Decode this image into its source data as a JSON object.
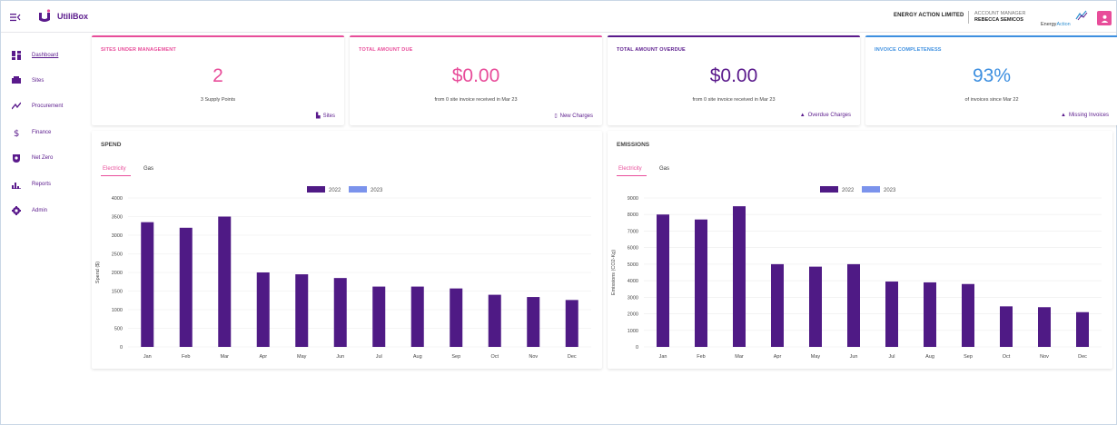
{
  "app": {
    "name": "UtiliBox"
  },
  "header": {
    "company": "ENERGY ACTION LIMITED",
    "account_label": "ACCOUNT MANAGER",
    "account_name": "REBECCA SEMICOS",
    "partner_logo_a": "Energy",
    "partner_logo_b": "Action"
  },
  "sidebar": {
    "items": [
      {
        "label": "Dashboard",
        "icon": "dashboard-icon",
        "active": true
      },
      {
        "label": "Sites",
        "icon": "sites-icon",
        "active": false
      },
      {
        "label": "Procurement",
        "icon": "procurement-icon",
        "active": false
      },
      {
        "label": "Finance",
        "icon": "dollar-icon",
        "active": false
      },
      {
        "label": "Net Zero",
        "icon": "leaf-icon",
        "active": false
      },
      {
        "label": "Reports",
        "icon": "bar-chart-icon",
        "active": false
      },
      {
        "label": "Admin",
        "icon": "gear-icon",
        "active": false
      }
    ]
  },
  "stats": [
    {
      "title": "SITES UNDER MANAGEMENT",
      "value": "2",
      "sub": "3 Supply Points",
      "link": "Sites",
      "color": "#e84d9a",
      "value_color": "#e84d9a"
    },
    {
      "title": "TOTAL AMOUNT DUE",
      "value": "$0.00",
      "sub": "from 0 site invoice received in Mar 23",
      "link": "New Charges",
      "color": "#e84d9a",
      "value_color": "#e84d9a"
    },
    {
      "title": "TOTAL AMOUNT OVERDUE",
      "value": "$0.00",
      "sub": "from 0 site invoice received in Mar 23",
      "link": "Overdue Charges",
      "color": "#5a1a8c",
      "value_color": "#5a1a8c"
    },
    {
      "title": "INVOICE COMPLETENESS",
      "value": "93%",
      "sub": "of invoices since Mar 22",
      "link": "Missing Invoices",
      "color": "#3d8fe0",
      "value_color": "#3d8fe0"
    }
  ],
  "charts": {
    "spend": {
      "title": "SPEND",
      "tab_active": "Electricity",
      "tab_inactive": "Gas"
    },
    "emissions": {
      "title": "EMISSIONS",
      "tab_active": "Electricity",
      "tab_inactive": "Gas"
    }
  },
  "colors": {
    "series_2022": "#4f1a85",
    "series_2023": "#7b93ec",
    "accent_pink": "#e84d9a",
    "brand_purple": "#5a1a8c",
    "invoice_blue": "#3d8fe0"
  },
  "chart_data": [
    {
      "type": "bar",
      "title": "SPEND",
      "ylabel": "Spend ($)",
      "xlabel": "",
      "categories": [
        "Jan",
        "Feb",
        "Mar",
        "Apr",
        "May",
        "Jun",
        "Jul",
        "Aug",
        "Sep",
        "Oct",
        "Nov",
        "Dec"
      ],
      "series": [
        {
          "name": "2022",
          "values": [
            3350,
            3200,
            3500,
            2000,
            1950,
            1850,
            1620,
            1620,
            1570,
            1400,
            1340,
            1260
          ]
        },
        {
          "name": "2023",
          "values": [
            0,
            0,
            0,
            0,
            0,
            0,
            0,
            0,
            0,
            0,
            0,
            0
          ]
        }
      ],
      "ylim": [
        0,
        4000
      ],
      "yticks": [
        0,
        500,
        1000,
        1500,
        2000,
        2500,
        3000,
        3500,
        4000
      ],
      "grid": true,
      "legend": "top-center"
    },
    {
      "type": "bar",
      "title": "EMISSIONS",
      "ylabel": "Emissions (CO2-Kg)",
      "xlabel": "",
      "categories": [
        "Jan",
        "Feb",
        "Mar",
        "Apr",
        "May",
        "Jun",
        "Jul",
        "Aug",
        "Sep",
        "Oct",
        "Nov",
        "Dec"
      ],
      "series": [
        {
          "name": "2022",
          "values": [
            8000,
            7700,
            8500,
            5000,
            4850,
            5000,
            3950,
            3900,
            3800,
            2450,
            2400,
            2100
          ]
        },
        {
          "name": "2023",
          "values": [
            0,
            0,
            0,
            0,
            0,
            0,
            0,
            0,
            0,
            0,
            0,
            0
          ]
        }
      ],
      "ylim": [
        0,
        9000
      ],
      "yticks": [
        0,
        1000,
        2000,
        3000,
        4000,
        5000,
        6000,
        7000,
        8000,
        9000
      ],
      "grid": true,
      "legend": "top-center"
    }
  ]
}
